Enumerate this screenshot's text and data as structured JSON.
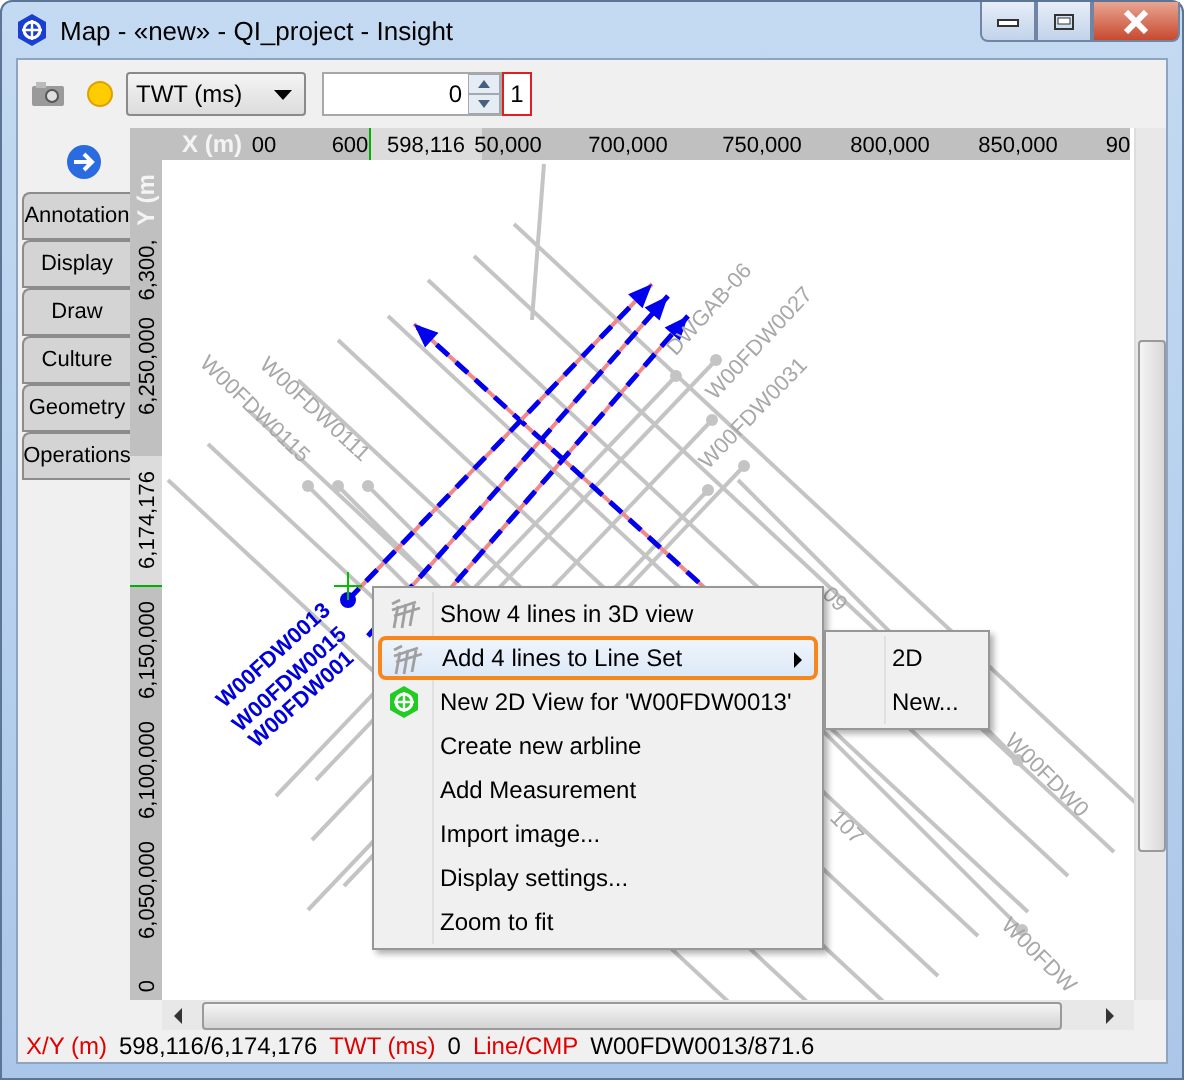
{
  "window": {
    "title": "Map - «new» - QI_project - Insight"
  },
  "toolbar": {
    "domain": "TWT (ms)",
    "value": "0",
    "step": "1"
  },
  "side_tabs": [
    {
      "label": "Annotation",
      "selected": false
    },
    {
      "label": "Display",
      "selected": false
    },
    {
      "label": "Draw",
      "selected": false
    },
    {
      "label": "Culture",
      "selected": false
    },
    {
      "label": "Geometry",
      "selected": false
    },
    {
      "label": "Operations",
      "selected": false
    }
  ],
  "map": {
    "x_axis": {
      "title": "X (m)",
      "cursor": "598,116",
      "ticks": [
        "00",
        "600",
        "50,000",
        "700,000",
        "750,000",
        "800,000",
        "850,000",
        "90"
      ]
    },
    "y_axis": {
      "title": "Y (m",
      "cursor": "6,174,176",
      "ticks": [
        "6,300,",
        "6,250,000",
        "6,150,000",
        "6,100,000",
        "6,050,000",
        "0"
      ]
    },
    "line_labels": [
      {
        "text": "W00FDW0115",
        "selected": false
      },
      {
        "text": "W00FDW0111",
        "selected": false
      },
      {
        "text": "DWGAB-06",
        "selected": false
      },
      {
        "text": "W00FDW0027",
        "selected": false
      },
      {
        "text": "W00FDW0031",
        "selected": false
      },
      {
        "text": "09",
        "selected": false
      },
      {
        "text": "107",
        "selected": false
      },
      {
        "text": "W00FDW0",
        "selected": false
      },
      {
        "text": "W00FDW",
        "selected": false
      },
      {
        "text": "W00FDW0013",
        "selected": true
      },
      {
        "text": "W00FDW0015",
        "selected": true
      },
      {
        "text": "W00FDW001",
        "selected": true
      }
    ]
  },
  "context_menu": {
    "items": [
      {
        "label": "Show 4 lines  in 3D view",
        "kind": "lines",
        "selected": false,
        "has_submenu": false
      },
      {
        "label": "Add 4 lines  to Line Set",
        "kind": "lines",
        "selected": true,
        "has_submenu": true
      },
      {
        "label": "New 2D View for 'W00FDW0013'",
        "kind": "view2d",
        "selected": false,
        "has_submenu": false
      },
      {
        "label": "Create new arbline",
        "selected": false,
        "has_submenu": false
      },
      {
        "label": "Add Measurement",
        "selected": false,
        "has_submenu": false
      },
      {
        "label": "Import image...",
        "selected": false,
        "has_submenu": false
      },
      {
        "label": "Display settings...",
        "selected": false,
        "has_submenu": false
      },
      {
        "label": "Zoom to fit",
        "selected": false,
        "has_submenu": false
      }
    ],
    "submenu": [
      "2D",
      "New..."
    ]
  },
  "status_bar": [
    {
      "label": "X/Y (m)",
      "value": "598,116/6,174,176"
    },
    {
      "label": "TWT (ms)",
      "value": "0"
    },
    {
      "label": "Line/CMP",
      "value": "W00FDW0013/871.6"
    }
  ]
}
